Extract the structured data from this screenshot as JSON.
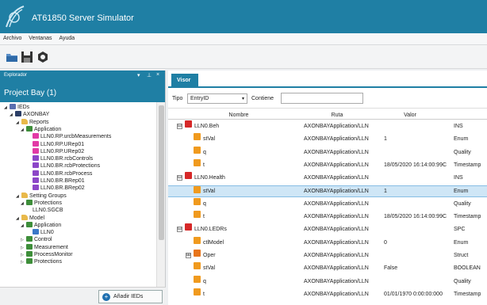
{
  "app": {
    "title": "AT61850 Server Simulator"
  },
  "menu": [
    "Archivo",
    "Ventanas",
    "Ayuda"
  ],
  "toolbar": {
    "icons": [
      "open-folder-icon",
      "save-icon",
      "settings-icon"
    ]
  },
  "explorer": {
    "header": "Explorador",
    "controls": [
      "▾",
      "⊥",
      "×"
    ],
    "project": "Project Bay (1)",
    "tree": [
      {
        "label": "IEDs",
        "icon": "ied",
        "tw": "◢"
      },
      {
        "label": "AXONBAY",
        "icon": "dark",
        "tw": "◢"
      },
      {
        "label": "Reports",
        "icon": "folder",
        "tw": "◢"
      },
      {
        "label": "Application",
        "icon": "green",
        "tw": "◢"
      },
      {
        "label": "LLN0.RP.urcbMeasurements",
        "icon": "pink",
        "tw": ""
      },
      {
        "label": "LLN0.RP.URep01",
        "icon": "pink",
        "tw": ""
      },
      {
        "label": "LLN0.RP.URep02",
        "icon": "pink",
        "tw": ""
      },
      {
        "label": "LLN0.BR.rcbControls",
        "icon": "purple",
        "tw": ""
      },
      {
        "label": "LLN0.BR.rcbProtections",
        "icon": "purple",
        "tw": ""
      },
      {
        "label": "LLN0.BR.rcbProcess",
        "icon": "purple",
        "tw": ""
      },
      {
        "label": "LLN0.BR.BRep01",
        "icon": "purple",
        "tw": ""
      },
      {
        "label": "LLN0.BR.BRep02",
        "icon": "purple",
        "tw": ""
      },
      {
        "label": "Setting Groups",
        "icon": "folder",
        "tw": "◢"
      },
      {
        "label": "Protections",
        "icon": "green",
        "tw": "◢"
      },
      {
        "label": "LLN0.SGCB",
        "icon": "",
        "tw": ""
      },
      {
        "label": "Model",
        "icon": "folder",
        "tw": "◢"
      },
      {
        "label": "Application",
        "icon": "green",
        "tw": "◢"
      },
      {
        "label": "LLN0",
        "icon": "blue",
        "tw": ""
      },
      {
        "label": "Control",
        "icon": "green",
        "tw": "▷"
      },
      {
        "label": "Measurement",
        "icon": "green",
        "tw": "▷"
      },
      {
        "label": "ProcessMonitor",
        "icon": "green",
        "tw": "▷"
      },
      {
        "label": "Protections",
        "icon": "green",
        "tw": "▷"
      }
    ],
    "add_button": "Añadir IEDs"
  },
  "viewer": {
    "tab": "Visor",
    "tipo_label": "Tipo",
    "tipo_value": "EntryID",
    "contiene_label": "Contiene",
    "columns": [
      "Nombre",
      "Ruta",
      "Valor",
      ""
    ],
    "rows": [
      {
        "badge": "ln",
        "exp": "⊟",
        "nombre": "LLN0.Beh",
        "ruta": "AXONBAYApplication/LLN",
        "valor": "",
        "tipo": "INS"
      },
      {
        "badge": "da",
        "exp": "",
        "nombre": "stVal",
        "ruta": "AXONBAYApplication/LLN",
        "valor": "1",
        "tipo": "Enum"
      },
      {
        "badge": "da",
        "exp": "",
        "nombre": "q",
        "ruta": "AXONBAYApplication/LLN",
        "valor": "",
        "tipo": "Quality"
      },
      {
        "badge": "da",
        "exp": "",
        "nombre": "t",
        "ruta": "AXONBAYApplication/LLN",
        "valor": "18/05/2020 16:14:00:99C",
        "tipo": "Timestamp"
      },
      {
        "badge": "ln",
        "exp": "⊟",
        "nombre": "LLN0.Health",
        "ruta": "AXONBAYApplication/LLN",
        "valor": "",
        "tipo": "INS"
      },
      {
        "badge": "da",
        "exp": "",
        "nombre": "stVal",
        "ruta": "AXONBAYApplication/LLN",
        "valor": "1",
        "tipo": "Enum",
        "selected": true
      },
      {
        "badge": "da",
        "exp": "",
        "nombre": "q",
        "ruta": "AXONBAYApplication/LLN",
        "valor": "",
        "tipo": "Quality"
      },
      {
        "badge": "da",
        "exp": "",
        "nombre": "t",
        "ruta": "AXONBAYApplication/LLN",
        "valor": "18/05/2020 16:14:00:99C",
        "tipo": "Timestamp"
      },
      {
        "badge": "ln",
        "exp": "⊟",
        "nombre": "LLN0.LEDRs",
        "ruta": "AXONBAYApplication/LLN",
        "valor": "",
        "tipo": "SPC"
      },
      {
        "badge": "da",
        "exp": "",
        "nombre": "ctlModel",
        "ruta": "AXONBAYApplication/LLN",
        "valor": "0",
        "tipo": "Enum"
      },
      {
        "badge": "do",
        "exp": "⊞",
        "nombre": "Oper",
        "ruta": "AXONBAYApplication/LLN",
        "valor": "",
        "tipo": "Struct"
      },
      {
        "badge": "da",
        "exp": "",
        "nombre": "stVal",
        "ruta": "AXONBAYApplication/LLN",
        "valor": "False",
        "tipo": "BOOLEAN"
      },
      {
        "badge": "da",
        "exp": "",
        "nombre": "q",
        "ruta": "AXONBAYApplication/LLN",
        "valor": "",
        "tipo": "Quality"
      },
      {
        "badge": "da",
        "exp": "",
        "nombre": "t",
        "ruta": "AXONBAYApplication/LLN",
        "valor": "01/01/1970 0:00:00:000",
        "tipo": "Timestamp"
      }
    ]
  }
}
